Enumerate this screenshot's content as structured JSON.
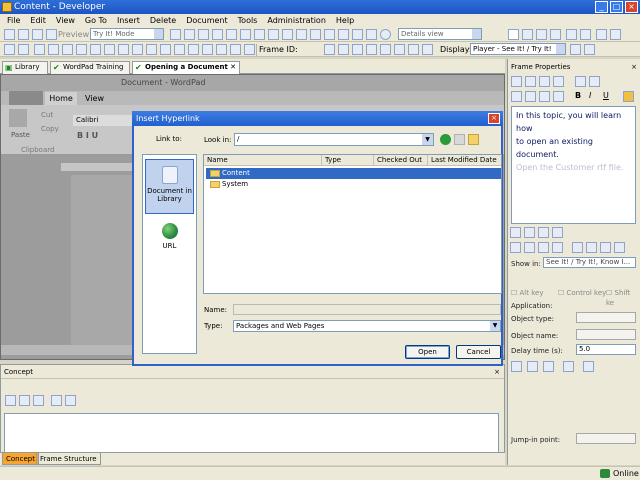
{
  "window": {
    "title": "Content - Developer"
  },
  "menu": [
    "File",
    "Edit",
    "View",
    "Go To",
    "Insert",
    "Delete",
    "Document",
    "Tools",
    "Administration",
    "Help"
  ],
  "toolbar": {
    "preview_label": "Preview",
    "mode_value": "Try It! Mode",
    "view_value": "Details view",
    "frame_id_label": "Frame ID:",
    "display_label": "Display:",
    "display_value": "Player - See It! / Try It!"
  },
  "doc_tabs": [
    {
      "label": "Library"
    },
    {
      "label": "WordPad Training"
    },
    {
      "label": "Opening a Document"
    }
  ],
  "wordpad_bg": {
    "title": "Document - WordPad",
    "tabs": [
      "Home",
      "View"
    ],
    "font": "Calibri",
    "paste": "Paste",
    "cut": "Cut",
    "copy": "Copy",
    "clipboard": "Clipboard"
  },
  "dialog": {
    "title": "Insert Hyperlink",
    "link_to_label": "Link to:",
    "look_in_label": "Look in:",
    "look_in_value": "/",
    "places": [
      {
        "label": "Document in Library"
      },
      {
        "label": "URL"
      }
    ],
    "columns": [
      "Name",
      "Type",
      "Checked Out By",
      "Last Modified Date"
    ],
    "rows": [
      {
        "name": "Content"
      },
      {
        "name": "System"
      }
    ],
    "name_label": "Name:",
    "name_value": "",
    "type_label": "Type:",
    "type_value": "Packages and Web Pages",
    "open_label": "Open",
    "cancel_label": "Cancel"
  },
  "concept": {
    "title": "Concept",
    "tabs": [
      "Concept",
      "Frame Structure"
    ]
  },
  "frame_properties": {
    "title": "Frame Properties",
    "text_line1": "In this topic, you will learn how",
    "text_line2": "to open an existing document.",
    "text_line3": "Open the Customer rtf file.",
    "show_in_label": "Show in:",
    "show_in_value": "See It! / Try It!, Know I...",
    "alt_key": "Alt key",
    "control_key": "Control key",
    "shift_key": "Shift ke",
    "application_label": "Application:",
    "object_type_label": "Object type:",
    "object_name_label": "Object name:",
    "delay_label": "Delay time (s):",
    "delay_value": "5.0",
    "jump_label": "Jump-in point:"
  },
  "status": {
    "online": "Online"
  }
}
